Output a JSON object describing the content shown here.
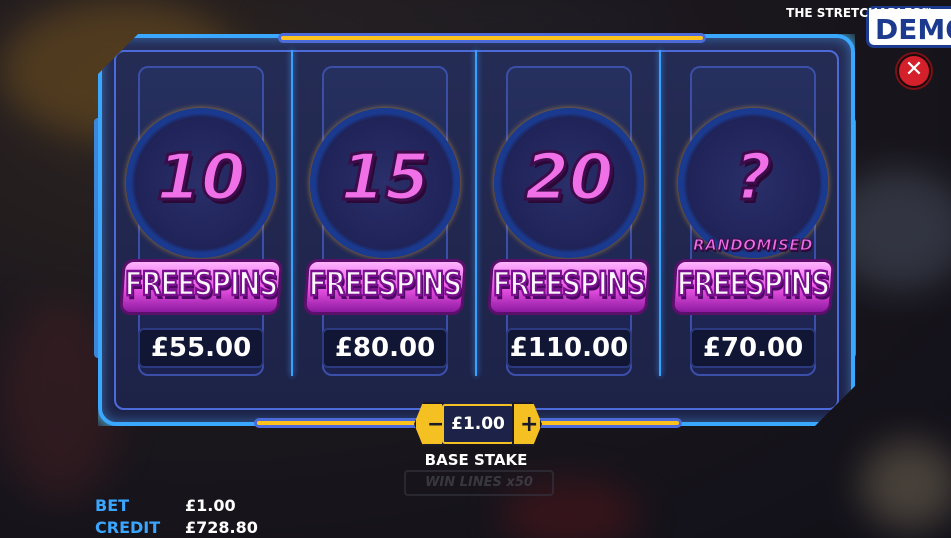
{
  "header": {
    "game_title": "THE STRETCHABLES™",
    "demo_label": "DEMO"
  },
  "close_icon": "close-icon",
  "options": [
    {
      "spins": "10",
      "label": "FREESPINS",
      "price": "£55.00",
      "randomised": ""
    },
    {
      "spins": "15",
      "label": "FREESPINS",
      "price": "£80.00",
      "randomised": ""
    },
    {
      "spins": "20",
      "label": "FREESPINS",
      "price": "£110.00",
      "randomised": ""
    },
    {
      "spins": "?",
      "label": "FREESPINS",
      "price": "£70.00",
      "randomised": "RANDOMISED"
    }
  ],
  "stake": {
    "value": "£1.00",
    "label": "BASE STAKE",
    "decrease_icon": "minus-icon",
    "increase_icon": "plus-icon"
  },
  "footer": {
    "bet_label": "BET",
    "bet_value": "£1.00",
    "credit_label": "CREDIT",
    "credit_value": "£728.80"
  },
  "background": {
    "win_lines": "WIN LINES x50"
  },
  "colors": {
    "panel_glow": "#3aa8ff",
    "accent_yellow": "#f4c022",
    "pink": "#f070e8",
    "close_red": "#d3202b"
  }
}
